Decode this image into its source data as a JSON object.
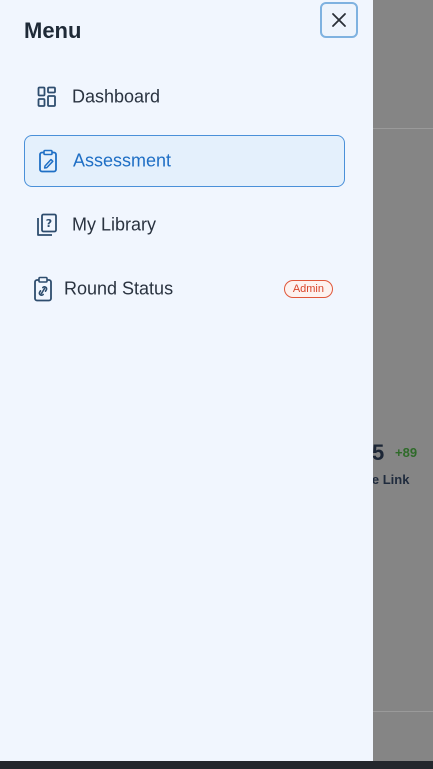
{
  "drawer": {
    "title": "Menu",
    "close_icon": "close-icon"
  },
  "nav": {
    "items": [
      {
        "label": "Dashboard",
        "icon": "dashboard-icon",
        "active": false
      },
      {
        "label": "Assessment",
        "icon": "clipboard-edit-icon",
        "active": true
      },
      {
        "label": "My Library",
        "icon": "question-library-icon",
        "active": false
      },
      {
        "label": "Round Status",
        "icon": "clipboard-link-icon",
        "active": false,
        "badge": "Admin"
      }
    ]
  },
  "background": {
    "stat_value": "5",
    "stat_delta": "+89",
    "stat_caption": "que Link"
  },
  "colors": {
    "drawer_bg": "#f1f6fe",
    "active_bg": "#e4f0fc",
    "active_border": "#4a90d9",
    "badge": "#d9452a"
  }
}
